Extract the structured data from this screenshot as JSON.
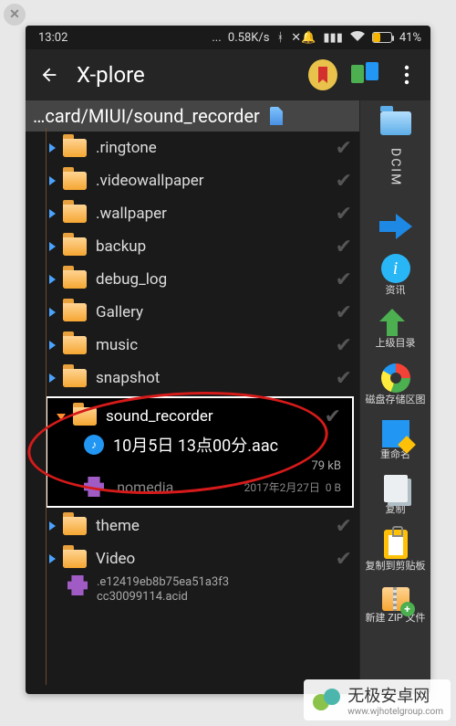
{
  "status": {
    "time": "13:02",
    "speed": "0.58K/s",
    "battery_pct": "41%"
  },
  "toolbar": {
    "title": "X-plore"
  },
  "breadcrumb": {
    "path": "…card/MIUI/sound_recorder"
  },
  "folders": {
    "f0": ".ringtone",
    "f1": ".videowallpaper",
    "f2": ".wallpaper",
    "f3": "backup",
    "f4": "debug_log",
    "f5": "Gallery",
    "f6": "music",
    "f7": "snapshot",
    "sel_name": "sound_recorder",
    "sel_file": "10月5日 13点00分.aac",
    "sel_size": "79 kB",
    "nomedia": ".nomedia",
    "nomedia_date": "2017年2月27日",
    "nomedia_size": "0 B",
    "f8": "theme",
    "f9": "Video",
    "acid1": ".e12419eb8b75ea51a3f3",
    "acid2": "cc30099114.acid"
  },
  "sidebar": {
    "dcim": "DCIM",
    "info": "资讯",
    "up": "上级目录",
    "disk": "磁盘存储区图",
    "rename": "重命名",
    "copy": "复制",
    "clip": "复制到剪贴板",
    "zip": "新建 ZIP 文件"
  },
  "watermark": {
    "brand": "无极安卓网",
    "url": "www.wjhotelgroup.com"
  }
}
